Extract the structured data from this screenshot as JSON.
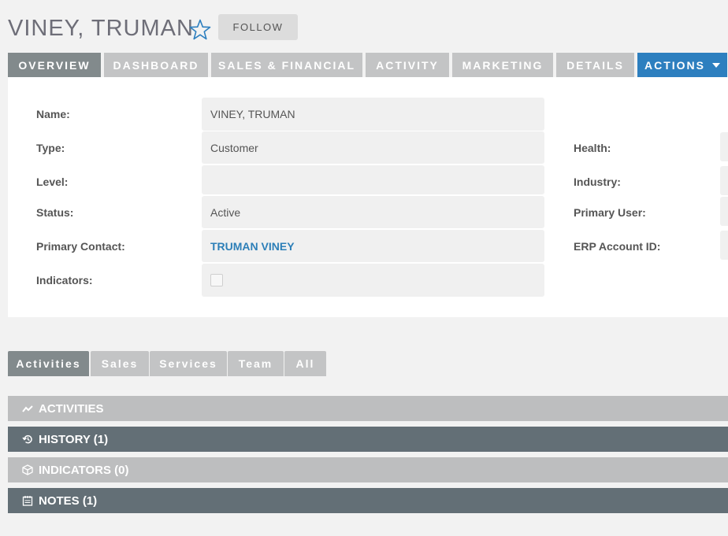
{
  "header": {
    "title": "VINEY, TRUMAN",
    "follow_label": "FOLLOW"
  },
  "tabs": [
    {
      "label": "OVERVIEW",
      "active": true
    },
    {
      "label": "DASHBOARD"
    },
    {
      "label": "SALES & FINANCIAL"
    },
    {
      "label": "ACTIVITY"
    },
    {
      "label": "MARKETING"
    },
    {
      "label": "DETAILS"
    },
    {
      "label": "ACTIONS"
    }
  ],
  "overview": {
    "name_label": "Name:",
    "name_value": "VINEY, TRUMAN",
    "type_label": "Type:",
    "type_value": "Customer",
    "level_label": "Level:",
    "level_value": "",
    "status_label": "Status:",
    "status_value": "Active",
    "primary_contact_label": "Primary Contact:",
    "primary_contact_value": "TRUMAN VINEY",
    "indicators_label": "Indicators:",
    "health_label": "Health:",
    "industry_label": "Industry:",
    "primary_user_label": "Primary User:",
    "erp_account_label": "ERP Account ID:"
  },
  "subtabs": [
    {
      "label": "Activities",
      "active": true
    },
    {
      "label": "Sales"
    },
    {
      "label": "Services"
    },
    {
      "label": "Team"
    },
    {
      "label": "All"
    }
  ],
  "panels": [
    {
      "label": "ACTIVITIES",
      "icon": "chart-line-icon"
    },
    {
      "label": "HISTORY (1)",
      "icon": "history-icon"
    },
    {
      "label": "INDICATORS (0)",
      "icon": "cube-icon"
    },
    {
      "label": "NOTES (1)",
      "icon": "notepad-icon"
    }
  ],
  "colors": {
    "accent": "#2d7fbf",
    "tab_inactive": "#c3c4c5",
    "tab_active": "#828a8c",
    "panel_dark": "#636f76",
    "panel_light": "#bdbebf"
  }
}
